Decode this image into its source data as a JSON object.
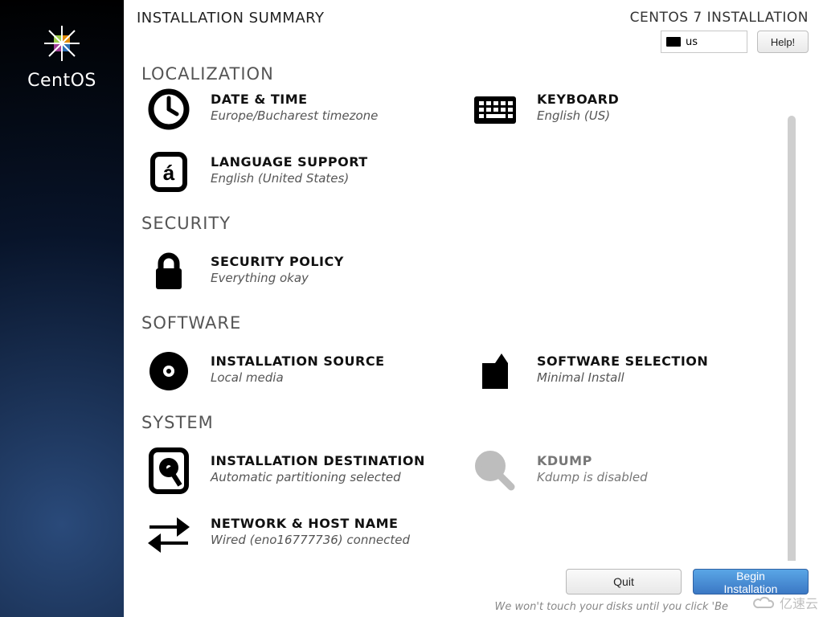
{
  "brand": {
    "name": "CentOS"
  },
  "header": {
    "title": "INSTALLATION SUMMARY",
    "install_label": "CENTOS 7 INSTALLATION",
    "keyboard_layout": "us",
    "help_label": "Help!"
  },
  "sections": {
    "localization": {
      "title": "LOCALIZATION",
      "datetime": {
        "title": "DATE & TIME",
        "sub": "Europe/Bucharest timezone"
      },
      "keyboard": {
        "title": "KEYBOARD",
        "sub": "English (US)"
      },
      "language": {
        "title": "LANGUAGE SUPPORT",
        "sub": "English (United States)"
      }
    },
    "security": {
      "title": "SECURITY",
      "policy": {
        "title": "SECURITY POLICY",
        "sub": "Everything okay"
      }
    },
    "software": {
      "title": "SOFTWARE",
      "source": {
        "title": "INSTALLATION SOURCE",
        "sub": "Local media"
      },
      "selection": {
        "title": "SOFTWARE SELECTION",
        "sub": "Minimal Install"
      }
    },
    "system": {
      "title": "SYSTEM",
      "destination": {
        "title": "INSTALLATION DESTINATION",
        "sub": "Automatic partitioning selected"
      },
      "kdump": {
        "title": "KDUMP",
        "sub": "Kdump is disabled"
      },
      "network": {
        "title": "NETWORK & HOST NAME",
        "sub": "Wired (eno16777736) connected"
      }
    }
  },
  "footer": {
    "quit_label": "Quit",
    "begin_label": "Begin Installation",
    "hint": "We won't touch your disks until you click 'Be"
  },
  "watermark": {
    "text": "亿速云"
  },
  "colors": {
    "accent": "#3b78c4",
    "sidebar_dark": "#08142a"
  }
}
